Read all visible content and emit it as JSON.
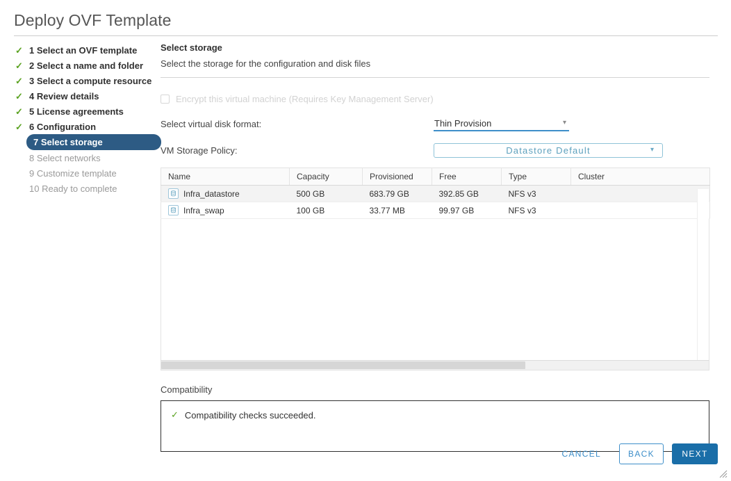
{
  "window": {
    "title": "Deploy OVF Template"
  },
  "steps": [
    {
      "label": "1 Select an OVF template",
      "state": "done"
    },
    {
      "label": "2 Select a name and folder",
      "state": "done"
    },
    {
      "label": "3 Select a compute resource",
      "state": "done"
    },
    {
      "label": "4 Review details",
      "state": "done"
    },
    {
      "label": "5 License agreements",
      "state": "done"
    },
    {
      "label": "6 Configuration",
      "state": "done"
    },
    {
      "label": "7 Select storage",
      "state": "current"
    },
    {
      "label": "8 Select networks",
      "state": "pending"
    },
    {
      "label": "9 Customize template",
      "state": "pending"
    },
    {
      "label": "10 Ready to complete",
      "state": "pending"
    }
  ],
  "pane": {
    "title": "Select storage",
    "subtitle": "Select the storage for the configuration and disk files"
  },
  "encrypt": {
    "label": "Encrypt this virtual machine (Requires Key Management Server)",
    "checked": false,
    "disabled": true
  },
  "disk_format": {
    "label": "Select virtual disk format:",
    "value": "Thin Provision",
    "caret": "chevron-down-icon"
  },
  "storage_policy": {
    "label": "VM Storage Policy:",
    "value": "Datastore Default",
    "caret": "chevron-down-icon"
  },
  "table": {
    "columns": [
      "Name",
      "Capacity",
      "Provisioned",
      "Free",
      "Type",
      "Cluster"
    ],
    "rows": [
      {
        "name": "Infra_datastore",
        "capacity": "500 GB",
        "provisioned": "683.79 GB",
        "free": "392.85 GB",
        "type": "NFS v3",
        "cluster": "",
        "selected": true
      },
      {
        "name": "Infra_swap",
        "capacity": "100 GB",
        "provisioned": "33.77 MB",
        "free": "99.97 GB",
        "type": "NFS v3",
        "cluster": "",
        "selected": false
      }
    ]
  },
  "compatibility": {
    "label": "Compatibility",
    "message": "Compatibility checks succeeded.",
    "status_icon": "check-icon"
  },
  "footer": {
    "cancel": "CANCEL",
    "back": "BACK",
    "next": "NEXT"
  },
  "colors": {
    "accent_blue": "#3d8ec9",
    "primary_button": "#1a6ea8",
    "step_active": "#2d5b84",
    "success_green": "#5aa220",
    "policy_text": "#5da0bd"
  }
}
